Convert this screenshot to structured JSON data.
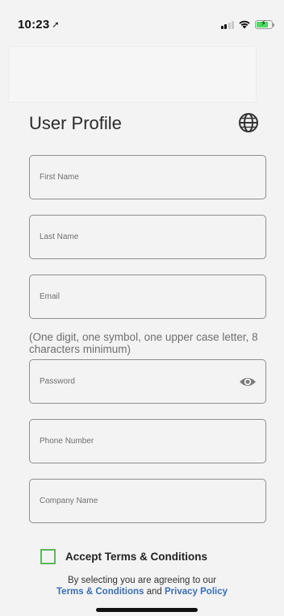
{
  "status_bar": {
    "time": "10:23",
    "location_arrow": "➚",
    "battery_color": "#4cd964"
  },
  "header": {
    "title": "User Profile",
    "language_icon": "globe-icon"
  },
  "form": {
    "first_name": {
      "placeholder": "First Name",
      "value": ""
    },
    "last_name": {
      "placeholder": "Last Name",
      "value": ""
    },
    "email": {
      "placeholder": "Email",
      "value": ""
    },
    "password_hint": "(One digit, one symbol, one upper case letter, 8 characters minimum)",
    "password": {
      "placeholder": "Password",
      "value": "",
      "toggle_icon": "eye-icon"
    },
    "phone": {
      "placeholder": "Phone Number",
      "value": ""
    },
    "company": {
      "placeholder": "Company Name",
      "value": ""
    }
  },
  "terms": {
    "checkbox_checked": false,
    "checkbox_color": "#5cb85c",
    "label": "Accept Terms & Conditions",
    "disclaimer_prefix": "By selecting you are agreeing to our",
    "terms_link": "Terms & Conditions",
    "conjunction": "and",
    "privacy_link": "Privacy Policy",
    "link_color": "#3a6fb4"
  }
}
